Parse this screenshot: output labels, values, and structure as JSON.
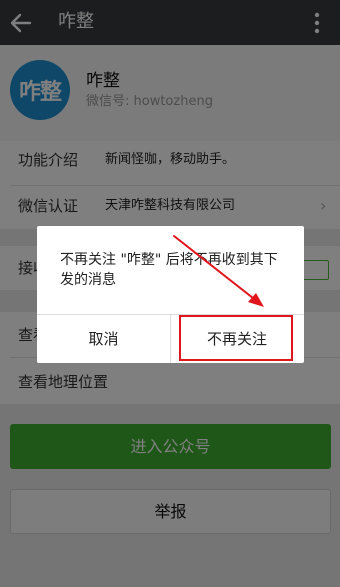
{
  "header": {
    "back_icon": "arrow-left-icon",
    "title": "咋整",
    "more_icon": "vertical-dots-icon"
  },
  "profile": {
    "avatar_text": "咋整",
    "name": "咋整",
    "wechat_id": "微信号: howtozheng"
  },
  "info": {
    "intro_label": "功能介绍",
    "intro_value": "新闻怪咖，移动助手。",
    "verify_label": "微信认证",
    "verify_value": "天津咋整科技有限公司",
    "receive_label": "接收消息",
    "history_label": "查看历史消息",
    "location_label": "查看地理位置"
  },
  "actions": {
    "enter_label": "进入公众号",
    "report_label": "举报"
  },
  "dialog": {
    "message": "不再关注 \"咋整\" 后将不再收到其下发的消息",
    "cancel_label": "取消",
    "confirm_label": "不再关注"
  },
  "colors": {
    "topbar": "#393a3f",
    "accent_green": "#3dae2f",
    "annotation_red": "#e0161c",
    "avatar_blue": "#1e8fd0"
  }
}
